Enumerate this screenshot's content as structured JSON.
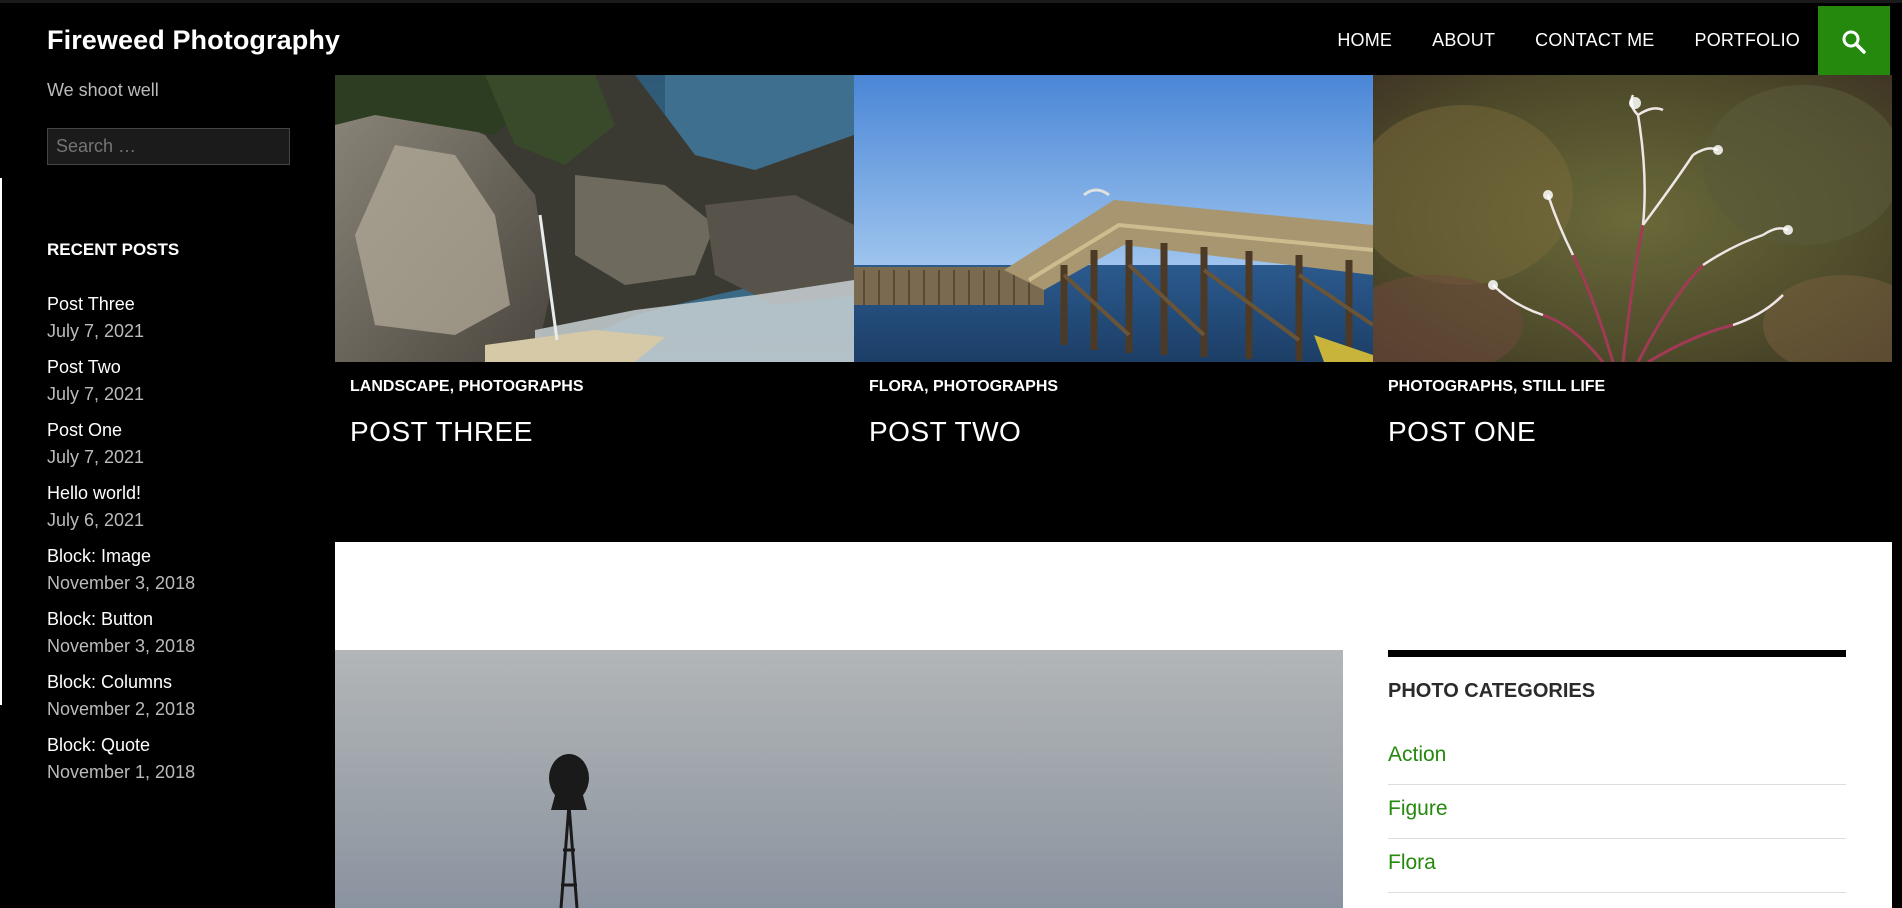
{
  "site": {
    "title": "Fireweed Photography",
    "tagline": "We shoot well"
  },
  "nav": {
    "items": [
      "HOME",
      "ABOUT",
      "CONTACT ME",
      "PORTFOLIO"
    ]
  },
  "search": {
    "placeholder": "Search …",
    "icon": "search-icon",
    "button_color": "#24890d"
  },
  "sidebar": {
    "recent_heading": "RECENT POSTS",
    "recent_posts": [
      {
        "title": "Post Three",
        "date": "July 7, 2021"
      },
      {
        "title": "Post Two",
        "date": "July 7, 2021"
      },
      {
        "title": "Post One",
        "date": "July 7, 2021"
      },
      {
        "title": "Hello world!",
        "date": "July 6, 2021"
      },
      {
        "title": "Block: Image",
        "date": "November 3, 2018"
      },
      {
        "title": "Block: Button",
        "date": "November 3, 2018"
      },
      {
        "title": "Block: Columns",
        "date": "November 2, 2018"
      },
      {
        "title": "Block: Quote",
        "date": "November 1, 2018"
      }
    ]
  },
  "featured": [
    {
      "categories": "LANDSCAPE, PHOTOGRAPHS",
      "title": "POST THREE"
    },
    {
      "categories": "FLORA, PHOTOGRAPHS",
      "title": "POST TWO"
    },
    {
      "categories": "PHOTOGRAPHS, STILL LIFE",
      "title": "POST ONE"
    }
  ],
  "photo_categories": {
    "heading": "PHOTO CATEGORIES",
    "items": [
      "Action",
      "Figure",
      "Flora"
    ]
  },
  "colors": {
    "accent": "#24890d",
    "background": "#000000"
  }
}
